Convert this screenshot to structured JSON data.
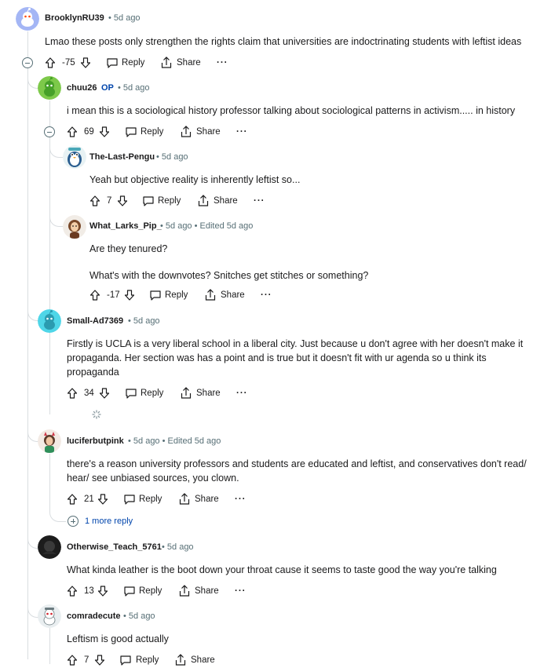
{
  "colors": {
    "accent": "#0045ac",
    "meta": "#576f76",
    "thread_line": "#d9dde0"
  },
  "comments": [
    {
      "id": "c1",
      "username": "BrooklynRU39",
      "op_badge": "",
      "meta": "• 5d ago",
      "body": [
        "Lmao these posts only strengthen the rights claim that universities are indoctrinating students with leftist ideas"
      ],
      "score": "-75",
      "avatar": "snoo-blue"
    },
    {
      "id": "c2",
      "username": "chuu26",
      "op_badge": "OP",
      "meta": "• 5d ago",
      "body": [
        "i mean this is a sociological history professor talking about sociological patterns in activism..... in history"
      ],
      "score": "69",
      "avatar": "snoo-green"
    },
    {
      "id": "c3",
      "username": "The-Last-Pengu",
      "op_badge": "",
      "meta": "• 5d ago",
      "body": [
        "Yeah but objective reality is inherently leftist so..."
      ],
      "score": "7",
      "avatar": "penguin"
    },
    {
      "id": "c4",
      "username": "What_Larks_Pip_",
      "op_badge": "",
      "meta": "• 5d ago • Edited 5d ago",
      "body": [
        "Are they tenured?",
        "What's with the downvotes? Snitches get stitches or something?"
      ],
      "score": "-17",
      "avatar": "custom-brown"
    },
    {
      "id": "c5",
      "username": "Small-Ad7369",
      "op_badge": "",
      "meta": "• 5d ago",
      "body": [
        "Firstly is UCLA is a very liberal school in a liberal city. Just because u don't agree with her doesn't make it propaganda. Her section was has a point and is true but it doesn't fit with ur agenda so u think its propaganda"
      ],
      "score": "34",
      "avatar": "snoo-cyan"
    },
    {
      "id": "c6",
      "username": "luciferbutpink",
      "op_badge": "",
      "meta": "• 5d ago • Edited 5d ago",
      "body": [
        "there's a reason university professors and students are educated and leftist, and conservatives don't read/ hear/ see unbiased sources, you clown."
      ],
      "score": "21",
      "avatar": "custom-pink"
    },
    {
      "id": "c7",
      "username": "Otherwise_Teach_5761",
      "op_badge": "",
      "meta": "• 5d ago",
      "body": [
        "What kinda leather is the boot down your throat cause it seems to taste good the way you're talking"
      ],
      "score": "13",
      "avatar": "dark"
    },
    {
      "id": "c8",
      "username": "comradecute",
      "op_badge": "",
      "meta": "• 5d ago",
      "body": [
        "Leftism is good actually"
      ],
      "score": "7",
      "avatar": "snoo-custom"
    }
  ],
  "labels": {
    "reply": "Reply",
    "share": "Share",
    "more_replies": "1 more reply"
  }
}
